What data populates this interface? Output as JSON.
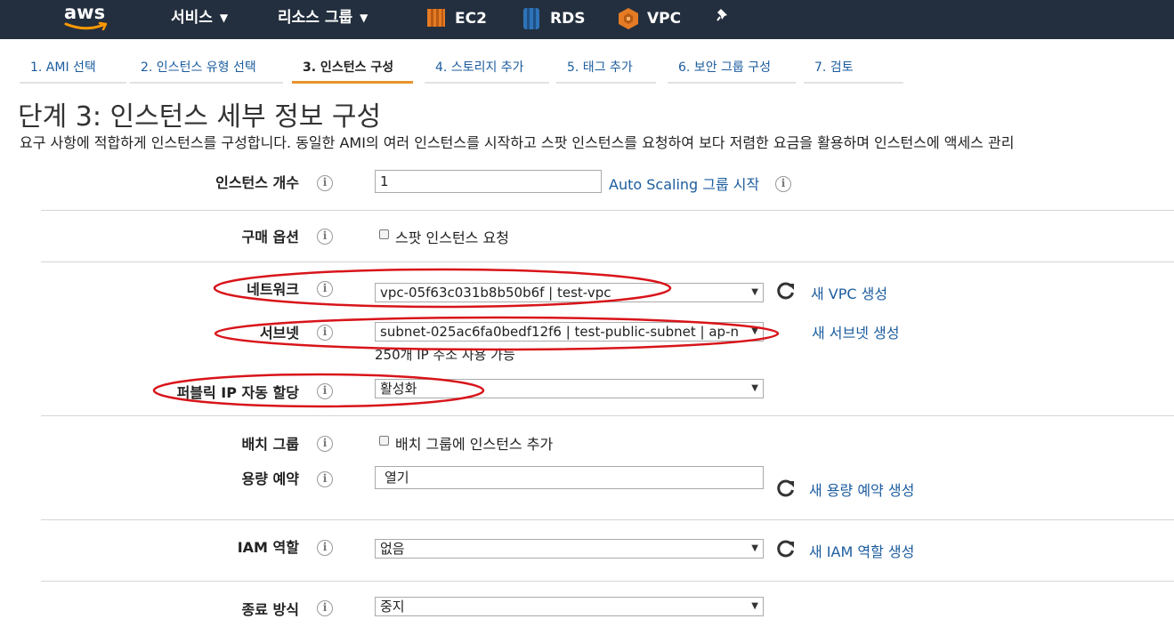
{
  "nav": {
    "logo_text": "aws",
    "services_label": "서비스",
    "resource_groups_label": "리소스 그룹",
    "shortcuts": [
      {
        "label": "EC2",
        "icon": "ec2-icon",
        "color": "#e57b25"
      },
      {
        "label": "RDS",
        "icon": "rds-icon",
        "color": "#2e73b8"
      },
      {
        "label": "VPC",
        "icon": "vpc-icon",
        "color": "#e57b25"
      }
    ],
    "pin_icon": "pin-icon"
  },
  "tabs": [
    {
      "label": "1. AMI 선택"
    },
    {
      "label": "2. 인스턴스 유형 선택"
    },
    {
      "label": "3. 인스턴스 구성"
    },
    {
      "label": "4. 스토리지 추가"
    },
    {
      "label": "5. 태그 추가"
    },
    {
      "label": "6. 보안 그룹 구성"
    },
    {
      "label": "7. 검토"
    }
  ],
  "active_tab_index": 2,
  "page": {
    "title": "단계 3: 인스턴스 세부 정보 구성",
    "description": "요구 사항에 적합하게 인스턴스를 구성합니다. 동일한 AMI의 여러 인스턴스를 시작하고 스팟 인스턴스를 요청하여 보다 저렴한 요금을 활용하며 인스턴스에 액세스 관리"
  },
  "form": {
    "instance_count": {
      "label": "인스턴스 개수",
      "value": "1",
      "link": "Auto Scaling 그룹 시작"
    },
    "purchase_option": {
      "label": "구매 옵션",
      "checkbox_label": "스팟 인스턴스 요청",
      "checked": false
    },
    "network": {
      "label": "네트워크",
      "value": "vpc-05f63c031b8b50b6f | test-vpc",
      "link": "새 VPC 생성"
    },
    "subnet": {
      "label": "서브넷",
      "value": "subnet-025ac6fa0bedf12f6 | test-public-subnet | ap-n",
      "note": "250개 IP 주소 사용 가능",
      "link": "새 서브넷 생성"
    },
    "public_ip": {
      "label": "퍼블릭 IP 자동 할당",
      "value": "활성화"
    },
    "placement_group": {
      "label": "배치 그룹",
      "checkbox_label": "배치 그룹에 인스턴스 추가",
      "checked": false
    },
    "capacity_reservation": {
      "label": "용량 예약",
      "value": "열기",
      "link": "새 용량 예약 생성"
    },
    "iam_role": {
      "label": "IAM 역할",
      "value": "없음",
      "link": "새 IAM 역할 생성"
    },
    "shutdown_behavior": {
      "label": "종료 방식",
      "value": "중지"
    }
  },
  "colors": {
    "nav_bg": "#232f3e",
    "link": "#1b5c9e",
    "active_tab": "#e7932c",
    "annotation": "#d8141a"
  }
}
